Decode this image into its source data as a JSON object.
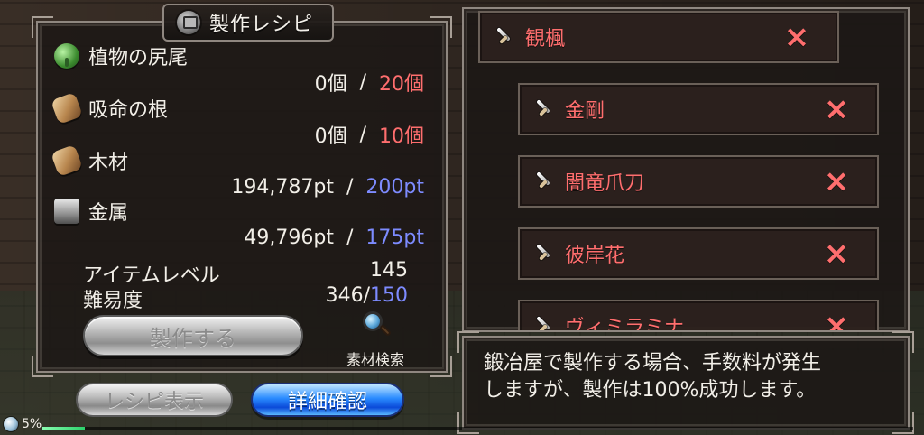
{
  "title": "製作レシピ",
  "materials": [
    {
      "name": "植物の尻尾",
      "have": "0個",
      "separator": "/",
      "need": "20個",
      "need_color": "red",
      "icon": "plant-icon"
    },
    {
      "name": "吸命の根",
      "have": "0個",
      "separator": "/",
      "need": "10個",
      "need_color": "red",
      "icon": "wood-icon"
    },
    {
      "name": "木材",
      "have": "194,787pt",
      "separator": "/",
      "need": "200pt",
      "need_color": "blue",
      "icon": "wood-icon"
    },
    {
      "name": "金属",
      "have": "49,796pt",
      "separator": "/",
      "need": "175pt",
      "need_color": "blue",
      "icon": "metal-icon"
    }
  ],
  "stats": {
    "item_level_label": "アイテムレベル",
    "item_level_value": "145",
    "difficulty_label": "難易度",
    "difficulty_have": "346/",
    "difficulty_need": "150"
  },
  "buttons": {
    "craft": "製作する",
    "material_search": "素材検索",
    "recipe_display": "レシピ表示",
    "details": "詳細確認"
  },
  "recipes": [
    {
      "name": "観楓"
    },
    {
      "name": "金剛"
    },
    {
      "name": "闇竜爪刀"
    },
    {
      "name": "彼岸花"
    },
    {
      "name": "ヴィミラミナ"
    }
  ],
  "message": "鍛冶屋で製作する場合、手数料が発生\nしますが、製作は100%成功します。",
  "status": {
    "percent": "5%",
    "progress": 0.05
  },
  "colors": {
    "red": "#ff6e6e",
    "blue": "#7d8bff"
  }
}
